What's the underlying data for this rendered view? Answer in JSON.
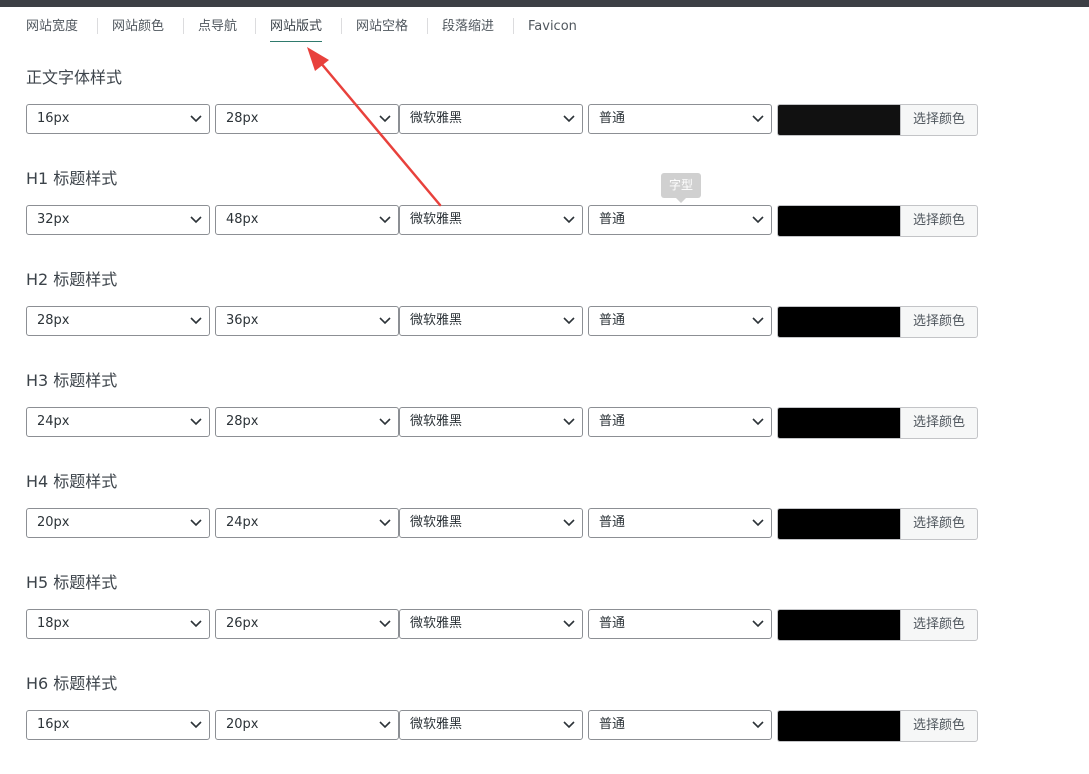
{
  "tabs": [
    {
      "label": "网站宽度",
      "active": false
    },
    {
      "label": "网站颜色",
      "active": false
    },
    {
      "label": "点导航",
      "active": false
    },
    {
      "label": "网站版式",
      "active": true
    },
    {
      "label": "网站空格",
      "active": false
    },
    {
      "label": "段落缩进",
      "active": false
    },
    {
      "label": "Favicon",
      "active": false
    }
  ],
  "color_button_label": "选择颜色",
  "tooltip_text": "字型",
  "sections": [
    {
      "title": "正文字体样式",
      "font_size": "16px",
      "line_height": "28px",
      "font_family": "微软雅黑",
      "weight": "普通",
      "color": "#111111"
    },
    {
      "title": "H1 标题样式",
      "font_size": "32px",
      "line_height": "48px",
      "font_family": "微软雅黑",
      "weight": "普通",
      "color": "#000000"
    },
    {
      "title": "H2 标题样式",
      "font_size": "28px",
      "line_height": "36px",
      "font_family": "微软雅黑",
      "weight": "普通",
      "color": "#000000"
    },
    {
      "title": "H3 标题样式",
      "font_size": "24px",
      "line_height": "28px",
      "font_family": "微软雅黑",
      "weight": "普通",
      "color": "#000000"
    },
    {
      "title": "H4 标题样式",
      "font_size": "20px",
      "line_height": "24px",
      "font_family": "微软雅黑",
      "weight": "普通",
      "color": "#000000"
    },
    {
      "title": "H5 标题样式",
      "font_size": "18px",
      "line_height": "26px",
      "font_family": "微软雅黑",
      "weight": "普通",
      "color": "#000000"
    },
    {
      "title": "H6 标题样式",
      "font_size": "16px",
      "line_height": "20px",
      "font_family": "微软雅黑",
      "weight": "普通",
      "color": "#000000"
    }
  ],
  "colors": {
    "accent": "#2f7a6d",
    "annotation_arrow": "#e8413c"
  }
}
